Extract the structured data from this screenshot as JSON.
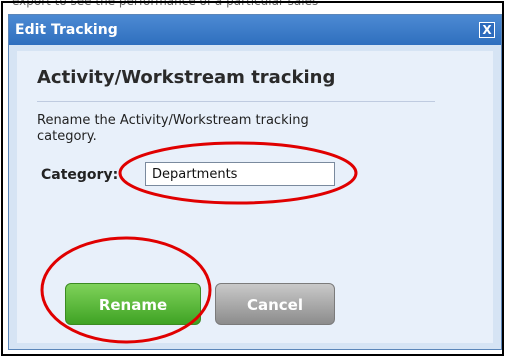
{
  "background": {
    "text": "export to see the performance of a particular sales"
  },
  "dialog": {
    "title": "Edit Tracking",
    "close_label": "X",
    "heading": "Activity/Workstream tracking",
    "description": "Rename the Activity/Workstream tracking category.",
    "category_label": "Category:",
    "category_value": "Departments",
    "rename_label": "Rename",
    "cancel_label": "Cancel"
  },
  "colors": {
    "titlebar": "#3b7ccd",
    "rename_button": "#4fb62b",
    "cancel_button": "#a3a3a3",
    "annotation": "#e00000"
  }
}
